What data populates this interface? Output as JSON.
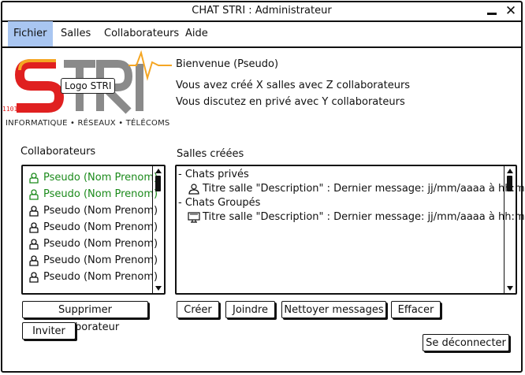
{
  "window": {
    "title": "CHAT STRI : Administrateur"
  },
  "menu": [
    {
      "label": "Fichier",
      "active": true
    },
    {
      "label": "Salles"
    },
    {
      "label": "Collaborateurs"
    },
    {
      "label": "Aide"
    }
  ],
  "logo": {
    "placeholder_label": "Logo STRI",
    "letters": "STRI",
    "binary": "1101100",
    "tagline": "INFORMATIQUE • RÉSEAUX • TÉLÉCOMS",
    "colors": {
      "orange": "#f5a623",
      "red": "#e02020",
      "gray": "#8a8a8a"
    }
  },
  "welcome": {
    "line1": "Bienvenue (Pseudo)",
    "line2": "Vous avez créé X salles avec Z collaborateurs",
    "line3": "Vous discutez en privé avec Y collaborateurs"
  },
  "collaborators": {
    "label": "Collaborateurs",
    "items": [
      {
        "text": "Pseudo (Nom Prenom)",
        "status": "online"
      },
      {
        "text": "Pseudo (Nom Prenom)",
        "status": "online"
      },
      {
        "text": "Pseudo (Nom Prenom)",
        "status": "offline"
      },
      {
        "text": "Pseudo (Nom Prenom)",
        "status": "offline"
      },
      {
        "text": "Pseudo (Nom Prenom)",
        "status": "offline"
      },
      {
        "text": "Pseudo (Nom Prenom)",
        "status": "offline"
      },
      {
        "text": "Pseudo (Nom Prenom)",
        "status": "offline"
      }
    ],
    "buttons": {
      "delete": "Supprimer collaborateur",
      "invite": "Inviter"
    }
  },
  "rooms": {
    "label": "Salles créées",
    "private_header": "- Chats privés",
    "private_item": "Titre salle \"Description\" : Dernier message: jj/mm/aaaa à hh:mm",
    "group_header": "- Chats Groupés",
    "group_item": "Titre salle \"Description\" : Dernier message: jj/mm/aaaa à hh:mm",
    "buttons": {
      "create": "Créer",
      "join": "Joindre",
      "clean": "Nettoyer messages",
      "erase": "Effacer"
    }
  },
  "logout": "Se déconnecter",
  "colors": {
    "online": "#1b8a1b",
    "menu_active": "#a9c6f1"
  }
}
